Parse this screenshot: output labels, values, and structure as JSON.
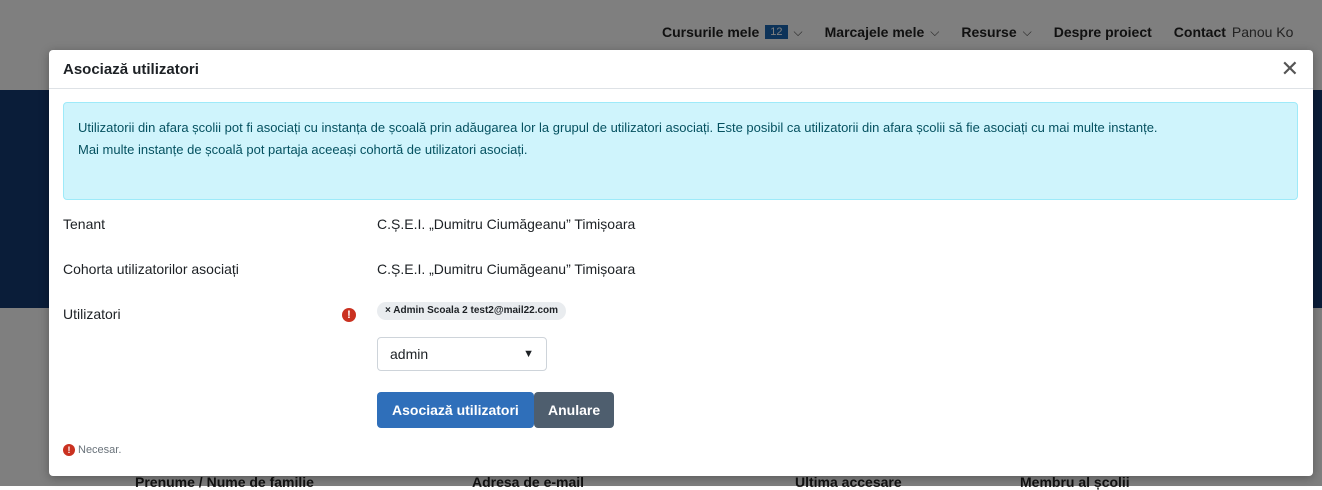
{
  "nav": {
    "items": [
      {
        "label": "Cursurile mele",
        "badge": "12",
        "chevron": true
      },
      {
        "label": "Marcajele mele",
        "chevron": true
      },
      {
        "label": "Resurse",
        "chevron": true
      },
      {
        "label": "Despre proiect"
      },
      {
        "label": "Contact"
      }
    ],
    "panel_label": "Panou Ko"
  },
  "background_table": {
    "headers": [
      "Prenume / Nume de familie",
      "Adresa de e-mail",
      "Ultima accesare",
      "Membru al școlii"
    ]
  },
  "modal": {
    "title": "Asociază utilizatori",
    "close_icon": "close-icon",
    "info_text_line1": "Utilizatorii din afara școlii pot fi asociați cu instanța de școală prin adăugarea lor la grupul de utilizatori asociați. Este posibil ca utilizatorii din afara școlii să fie asociați cu mai multe instanțe.",
    "info_text_line2": "Mai multe instanțe de școală pot partaja aceeași cohortă de utilizatori asociați.",
    "tenant_label": "Tenant",
    "tenant_value": "C.Ș.E.I. „Dumitru Ciumăgeanu” Timișoara",
    "cohort_label": "Cohorta utilizatorilor asociați",
    "cohort_value": "C.Ș.E.I. „Dumitru Ciumăgeanu” Timișoara",
    "users_label": "Utilizatori",
    "selected_user_chip": "× Admin Scoala 2 test2@mail22.com",
    "search_select_value": "admin",
    "submit_label": "Asociază utilizatori",
    "cancel_label": "Anulare",
    "required_note": "Necesar.",
    "required_icon": "!"
  },
  "colors": {
    "primary": "#2f6fba",
    "secondary": "#4e5e6e",
    "alert_bg": "#cff4fc",
    "required": "#ca3120",
    "hero": "#143a72"
  }
}
